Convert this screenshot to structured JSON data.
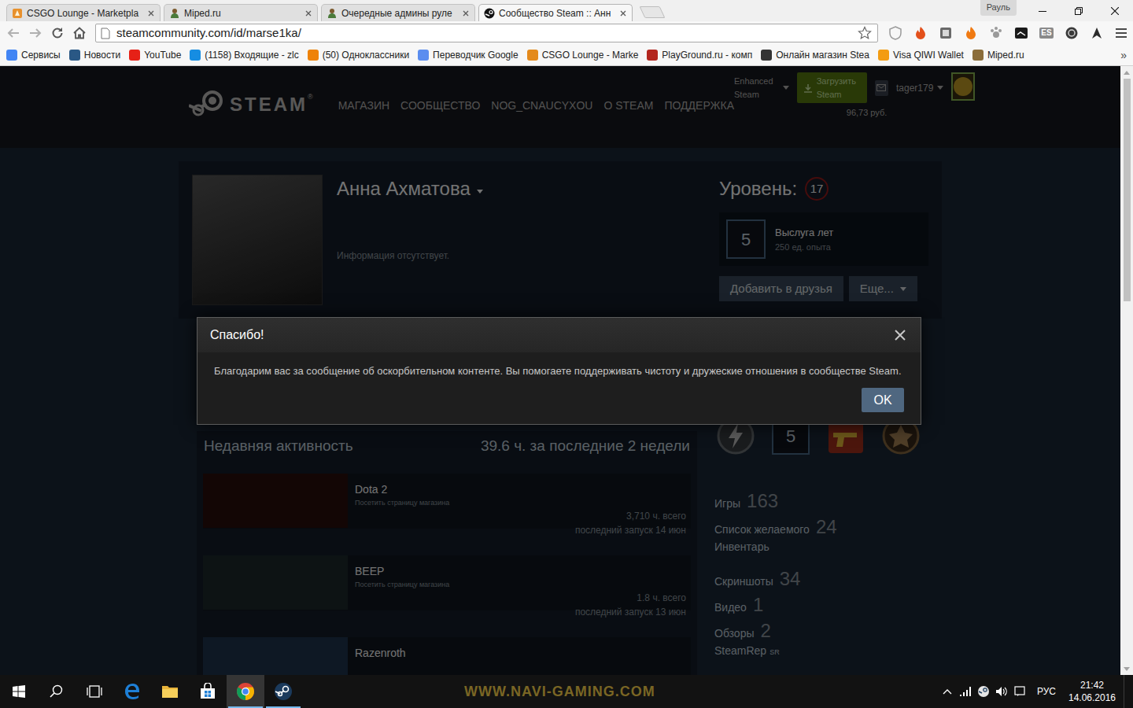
{
  "browser": {
    "tabs": [
      {
        "label": "CSGO Lounge - Marketpla",
        "selected": false,
        "kind": "lounge"
      },
      {
        "label": "Miped.ru",
        "selected": false,
        "kind": "miped"
      },
      {
        "label": "Очередные админы руле",
        "selected": false,
        "kind": "miped"
      },
      {
        "label": "Сообщество Steam :: Анн",
        "selected": true,
        "kind": "steam"
      }
    ],
    "profile_button": "Рауль",
    "address": "steamcommunity.com/id/marse1ka/",
    "extension_badge": "ES",
    "bookmarks": [
      {
        "label": "Сервисы",
        "color": "#4285f4"
      },
      {
        "label": "Новости",
        "color": "#2a5885"
      },
      {
        "label": "YouTube",
        "color": "#e62117"
      },
      {
        "label": "(1158) Входящие - zlc",
        "color": "#168de2"
      },
      {
        "label": "(50) Одноклассники",
        "color": "#ee8208"
      },
      {
        "label": "Переводчик Google",
        "color": "#5b8def"
      },
      {
        "label": "CSGO Lounge - Marke",
        "color": "#e48a1c"
      },
      {
        "label": "PlayGround.ru - комп",
        "color": "#b3261e"
      },
      {
        "label": "Онлайн магазин Stea",
        "color": "#333333"
      },
      {
        "label": "Visa QIWI Wallet",
        "color": "#f39c12"
      },
      {
        "label": "Miped.ru",
        "color": "#8b6d3a"
      }
    ],
    "bookmarks_more": "»"
  },
  "steam": {
    "logo": "STEAM",
    "logo_mark": "®",
    "nav": [
      "МАГАЗИН",
      "СООБЩЕСТВО",
      "NOG_CNAUCYXOU",
      "О STEAM",
      "ПОДДЕРЖКА"
    ],
    "account": {
      "enhanced": "Enhanced Steam",
      "install": "Загрузить Steam",
      "username": "tager179",
      "balance": "96,73 руб."
    },
    "profile": {
      "name": "Анна Ахматова",
      "summary": "Информация отсутствует.",
      "level_label": "Уровень:",
      "level": "17",
      "badge": {
        "number": "5",
        "title": "Выслуга лет",
        "xp": "250 ед. опыта"
      },
      "buttons": [
        "Добавить в друзья",
        "Еще..."
      ]
    },
    "activity": {
      "title": "Недавняя активность",
      "summary": "39.6 ч. за последние 2 недели",
      "games": [
        {
          "name": "Dota 2",
          "link": "Посетить страницу магазина",
          "hours": "3,710 ч. всего",
          "last": "последний запуск 14 июн",
          "color": "#2a0f0c"
        },
        {
          "name": "BEEP",
          "link": "Посетить страницу магазина",
          "hours": "1.8 ч. всего",
          "last": "последний запуск 13 июн",
          "color": "#1d2a2e"
        },
        {
          "name": "Razenroth",
          "color": "#1f3550"
        }
      ]
    },
    "showcase_badges": [
      {
        "kind": "bolt"
      },
      {
        "kind": "years",
        "text": "5"
      },
      {
        "kind": "gun"
      },
      {
        "kind": "emblem"
      }
    ],
    "stats": [
      {
        "label": "Игры",
        "count": "163"
      },
      {
        "label": "Список желаемого",
        "count": "24"
      },
      {
        "label": "Инвентарь"
      },
      {
        "label": "Скриншоты",
        "count": "34"
      },
      {
        "label": "Видео",
        "count": "1"
      },
      {
        "label": "Обзоры",
        "count": "2"
      },
      {
        "label": "SteamRep",
        "sup": "SR"
      }
    ]
  },
  "dialog": {
    "title": "Спасибо!",
    "message": "Благодарим вас за сообщение об оскорбительном контенте. Вы помогаете поддерживать чистоту и дружеские отношения в сообществе Steam.",
    "buttons": [
      "OK"
    ]
  },
  "taskbar": {
    "buttons": [
      {
        "kind": "start",
        "running": false,
        "selected": false
      },
      {
        "kind": "search",
        "running": false,
        "selected": false
      },
      {
        "kind": "taskview",
        "running": false,
        "selected": false
      },
      {
        "kind": "edge",
        "running": false,
        "selected": false
      },
      {
        "kind": "explorer",
        "running": false,
        "selected": false
      },
      {
        "kind": "store",
        "running": false,
        "selected": false
      },
      {
        "kind": "chrome",
        "running": true,
        "selected": true
      },
      {
        "kind": "steam",
        "running": true,
        "selected": false
      }
    ],
    "watermark": "WWW.NAVI-GAMING.COM",
    "language": "РУС",
    "time": "21:42",
    "date": "14.06.2016"
  }
}
